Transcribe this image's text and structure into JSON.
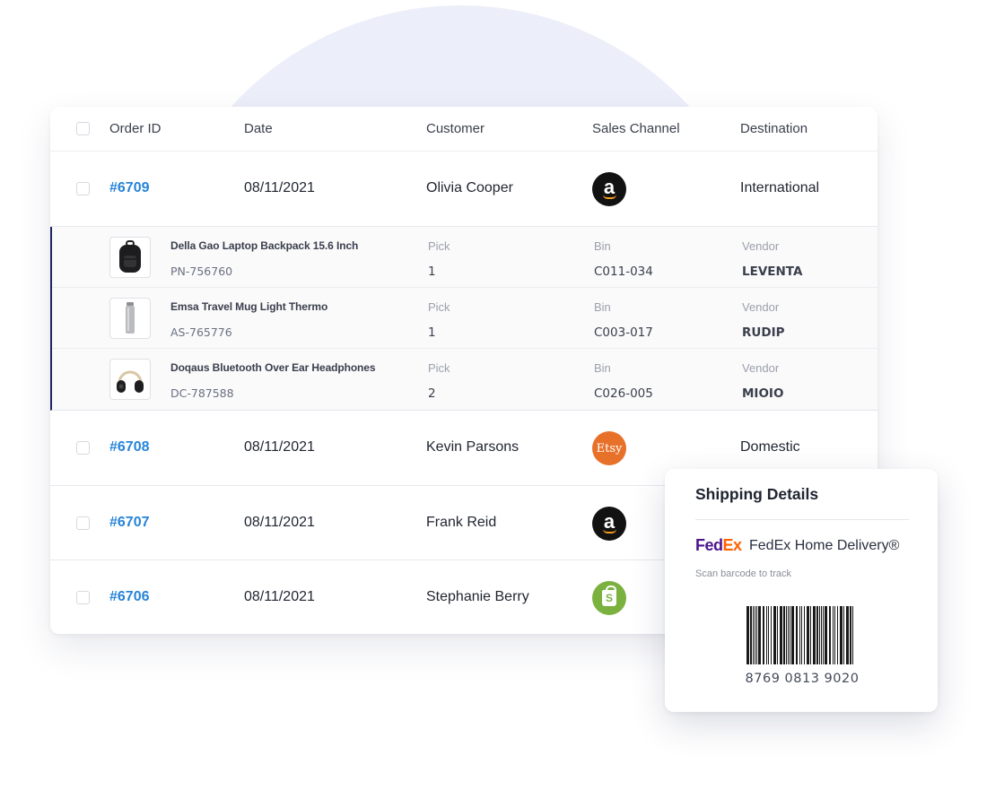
{
  "table": {
    "headers": {
      "order_id": "Order ID",
      "date": "Date",
      "customer": "Customer",
      "sales_channel": "Sales Channel",
      "destination": "Destination"
    },
    "orders": [
      {
        "id": "#6709",
        "date": "08/11/2021",
        "customer": "Olivia Cooper",
        "channel": "amazon",
        "channel_glyph": "a",
        "destination": "International"
      },
      {
        "id": "#6708",
        "date": "08/11/2021",
        "customer": "Kevin Parsons",
        "channel": "etsy",
        "channel_glyph": "Etsy",
        "destination": "Domestic"
      },
      {
        "id": "#6707",
        "date": "08/11/2021",
        "customer": "Frank Reid",
        "channel": "amazon",
        "channel_glyph": "a",
        "destination": ""
      },
      {
        "id": "#6706",
        "date": "08/11/2021",
        "customer": "Stephanie Berry",
        "channel": "shopify",
        "channel_glyph": "S",
        "destination": ""
      }
    ],
    "items": [
      {
        "name": "Della Gao Laptop Backpack 15.6 Inch",
        "sku": "PN-756760",
        "pick_label": "Pick",
        "pick": "1",
        "bin_label": "Bin",
        "bin": "C011-034",
        "vendor_label": "Vendor",
        "vendor": "LEVENTA",
        "icon": "backpack-icon"
      },
      {
        "name": "Emsa Travel Mug Light Thermo",
        "sku": "AS-765776",
        "pick_label": "Pick",
        "pick": "1",
        "bin_label": "Bin",
        "bin": "C003-017",
        "vendor_label": "Vendor",
        "vendor": "RUDIP",
        "icon": "mug-icon"
      },
      {
        "name": "Doqaus Bluetooth Over Ear Headphones",
        "sku": "DC-787588",
        "pick_label": "Pick",
        "pick": "2",
        "bin_label": "Bin",
        "bin": "C026-005",
        "vendor_label": "Vendor",
        "vendor": "MIOIO",
        "icon": "headphones-icon"
      }
    ]
  },
  "shipping": {
    "title": "Shipping Details",
    "carrier_logo_fed": "Fed",
    "carrier_logo_ex": "Ex",
    "service": "FedEx Home Delivery®",
    "scan_hint": "Scan barcode to track",
    "tracking_number": "8769 0813 9020"
  },
  "colors": {
    "order_link": "#2684d8",
    "fedex_purple": "#4d148c",
    "fedex_orange": "#ff6200",
    "amazon_bg": "#121212",
    "etsy_bg": "#e8712a",
    "shopify_bg": "#7ab13f",
    "expanded_accent": "#1c2760"
  }
}
